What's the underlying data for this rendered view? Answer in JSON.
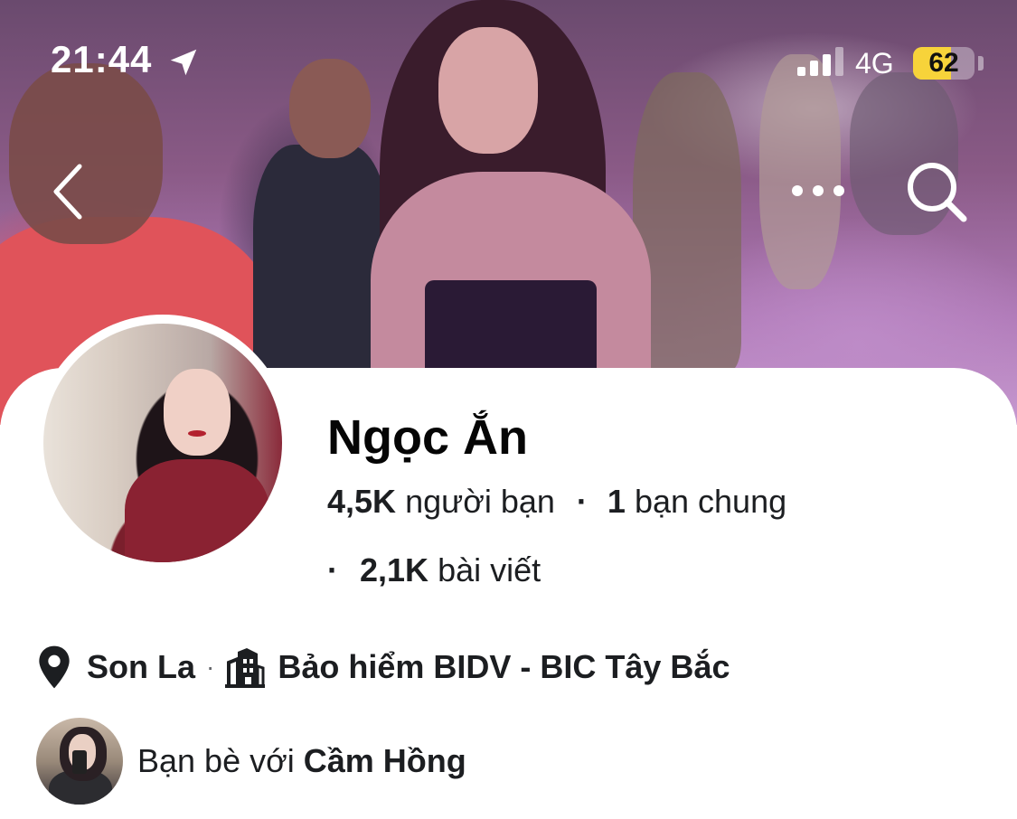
{
  "status_bar": {
    "time": "21:44",
    "location_icon": "location-arrow-icon",
    "signal_icon": "cellular-signal-icon",
    "network": "4G",
    "battery_percent": "62",
    "battery_level": 0.62,
    "battery_color": "#f7d33a"
  },
  "nav": {
    "back_icon": "chevron-left-icon",
    "more_icon": "more-horizontal-icon",
    "search_icon": "search-icon"
  },
  "profile": {
    "name": "Ngọc Ắn",
    "friends_count": "4,5K",
    "friends_label": "người bạn",
    "separator": "·",
    "mutual_count": "1",
    "mutual_label": "bạn chung",
    "posts_count": "2,1K",
    "posts_label": "bài viết"
  },
  "info": {
    "location_icon": "location-pin-icon",
    "location": "Son La",
    "separator": "·",
    "work_icon": "building-icon",
    "work": "Bảo hiểm BIDV - BIC Tây Bắc"
  },
  "mutual_friend": {
    "prefix": "Bạn bè với",
    "name": "Cầm Hồng"
  },
  "colors": {
    "text_primary": "#050505",
    "text_secondary": "#65676b",
    "card_background": "#ffffff"
  }
}
